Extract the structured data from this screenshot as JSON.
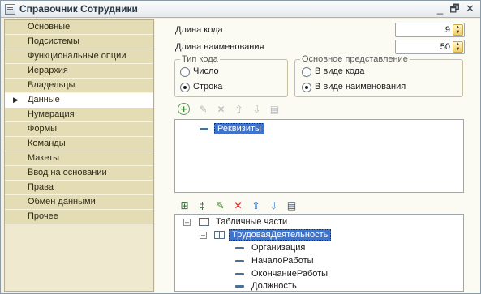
{
  "window": {
    "title": "Справочник Сотрудники"
  },
  "window_controls": {
    "minimize": "_",
    "restore": "🗗",
    "close": "✕"
  },
  "nav": {
    "items": [
      {
        "label": "Основные"
      },
      {
        "label": "Подсистемы"
      },
      {
        "label": "Функциональные опции"
      },
      {
        "label": "Иерархия"
      },
      {
        "label": "Владельцы"
      },
      {
        "label": "Данные",
        "active": true
      },
      {
        "label": "Нумерация"
      },
      {
        "label": "Формы"
      },
      {
        "label": "Команды"
      },
      {
        "label": "Макеты"
      },
      {
        "label": "Ввод на основании"
      },
      {
        "label": "Права"
      },
      {
        "label": "Обмен данными"
      },
      {
        "label": "Прочее"
      }
    ]
  },
  "fields": {
    "code_length": {
      "label": "Длина кода",
      "value": "9"
    },
    "name_length": {
      "label": "Длина наименования",
      "value": "50"
    }
  },
  "code_type": {
    "title": "Тип кода",
    "options": [
      {
        "label": "Число",
        "selected": false
      },
      {
        "label": "Строка",
        "selected": true
      }
    ]
  },
  "main_presentation": {
    "title": "Основное представление",
    "options": [
      {
        "label": "В виде кода",
        "selected": false
      },
      {
        "label": "В виде наименования",
        "selected": true
      }
    ]
  },
  "attributes_pane": {
    "toolbar": [
      "add-icon",
      "edit-icon",
      "delete-icon",
      "move-up-icon",
      "move-down-icon",
      "sort-icon"
    ],
    "items": [
      {
        "label": "Реквизиты",
        "selected": true
      }
    ]
  },
  "tabular_pane": {
    "toolbar": [
      "add-table-icon",
      "add-attribute-icon",
      "edit-icon",
      "delete-icon",
      "move-up-icon",
      "move-down-icon",
      "sort-icon"
    ],
    "root": {
      "label": "Табличные части"
    },
    "table": {
      "label": "ТрудоваяДеятельность",
      "selected": true
    },
    "columns": [
      "Организация",
      "НачалоРаботы",
      "ОкончаниеРаботы",
      "Должность"
    ]
  },
  "colors": {
    "accent": "#3f74cc",
    "nav_bg": "#e3dcb5",
    "panel_bg": "#fbfaf3"
  }
}
